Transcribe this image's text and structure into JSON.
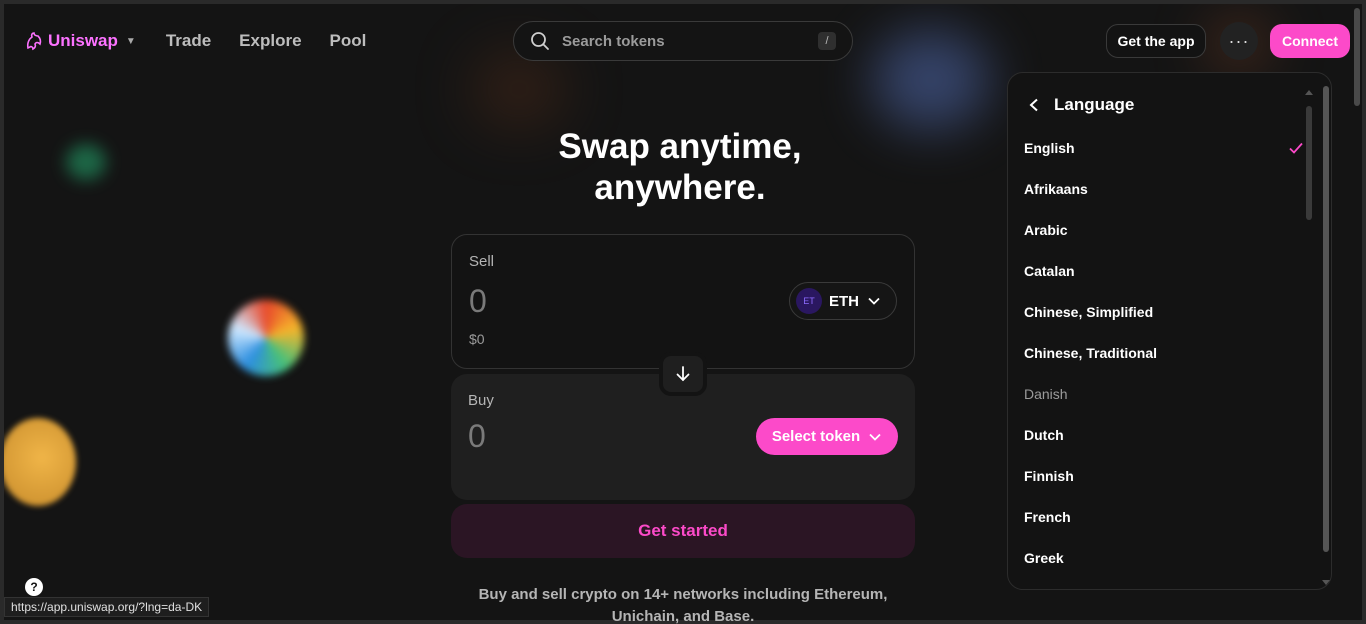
{
  "header": {
    "brand": "Uniswap",
    "nav": [
      "Trade",
      "Explore",
      "Pool"
    ],
    "search_placeholder": "Search tokens",
    "search_shortcut": "/",
    "get_app": "Get the app",
    "more": "···",
    "connect": "Connect"
  },
  "hero": {
    "line1": "Swap anytime,",
    "line2": "anywhere."
  },
  "sell": {
    "label": "Sell",
    "amount": "0",
    "usd": "$0",
    "token_icon_text": "ET",
    "token": "ETH"
  },
  "buy": {
    "label": "Buy",
    "amount": "0",
    "select_token": "Select token"
  },
  "get_started": "Get started",
  "tagline": "Buy and sell crypto on 14+ networks including Ethereum, Unichain, and Base.",
  "language_panel": {
    "title": "Language",
    "selected": "English",
    "hovered": "Danish",
    "items": [
      "English",
      "Afrikaans",
      "Arabic",
      "Catalan",
      "Chinese, Simplified",
      "Chinese, Traditional",
      "Danish",
      "Dutch",
      "Finnish",
      "French",
      "Greek"
    ]
  },
  "help": "?",
  "status_url": "https://app.uniswap.org/?lng=da-DK",
  "colors": {
    "accent": "#fc4ac9",
    "brand": "#fc72ff",
    "background": "#131313"
  }
}
